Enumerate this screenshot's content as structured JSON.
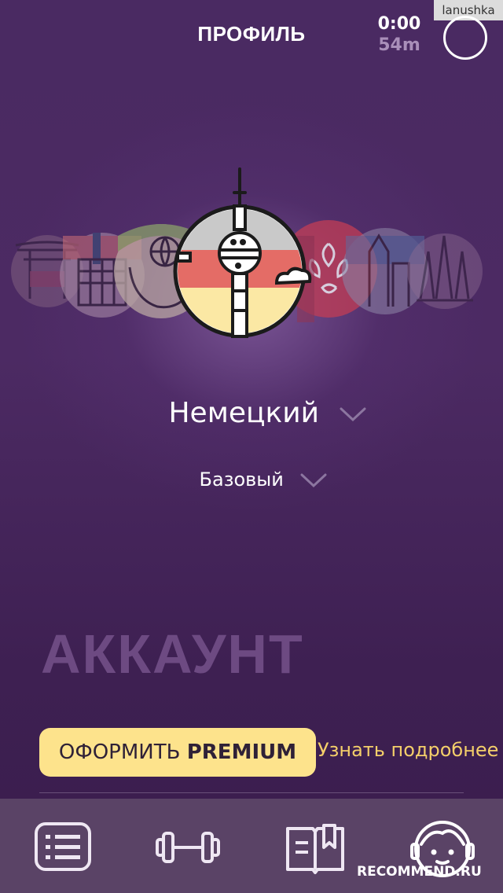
{
  "header": {
    "title": "ПРОФИЛЬ",
    "timer_time": "0:00",
    "timer_goal": "54m"
  },
  "watermark": {
    "username": "lanushka",
    "site": "RECOMMEND.RU"
  },
  "language": {
    "name": "Немецкий",
    "level": "Базовый"
  },
  "carousel": {
    "selected": "german-flag-tv-tower",
    "items": [
      "japan-torii",
      "norway-flag",
      "world-hands",
      "german-flag-tv-tower",
      "hong-kong-flag",
      "sweden-city",
      "spain-sagrada"
    ]
  },
  "account": {
    "section_title": "АККАУНТ",
    "premium_label_prefix": "ОФОРМИТЬ",
    "premium_label_strong": "PREMIUM",
    "more_link": "Узнать подробнее"
  },
  "tabs": [
    {
      "icon": "list-icon"
    },
    {
      "icon": "dumbbell-icon"
    },
    {
      "icon": "book-icon"
    },
    {
      "icon": "profile-face-icon",
      "active": true
    }
  ],
  "colors": {
    "accent_yellow": "#fde38c",
    "link_yellow": "#f4cf6a",
    "background": "#3c1f4f",
    "tabbar": "#5a4366"
  }
}
